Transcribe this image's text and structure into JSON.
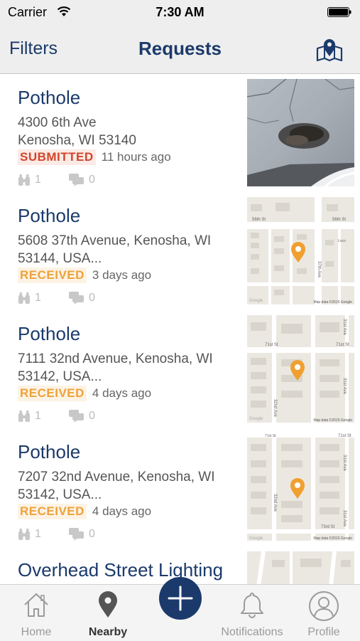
{
  "status_bar": {
    "carrier": "Carrier",
    "time": "7:30 AM"
  },
  "nav": {
    "filters_label": "Filters",
    "title": "Requests",
    "map_icon": "map-pin-icon"
  },
  "requests": [
    {
      "title": "Pothole",
      "address": "4300 6th Ave\nKenosha, WI 53140",
      "status": "SUBMITTED",
      "age": "11 hours ago",
      "supporters": "1",
      "comments": "0",
      "thumb": "photo"
    },
    {
      "title": "Pothole",
      "address": "5608 37th Avenue, Kenosha, WI 53144, USA...",
      "status": "RECEIVED",
      "age": "3 days ago",
      "supporters": "1",
      "comments": "0",
      "thumb": "map",
      "map_labels": [
        "56th St",
        "56th St",
        "37th Ave",
        "Loco",
        "Google",
        "Map data ©2015 Google"
      ]
    },
    {
      "title": "Pothole",
      "address": "7111 32nd Avenue, Kenosha, WI 53142, USA...",
      "status": "RECEIVED",
      "age": "4 days ago",
      "supporters": "1",
      "comments": "0",
      "thumb": "map",
      "map_labels": [
        "71st St",
        "71st St",
        "31st Ave",
        "32nd Ave",
        "31st Ave",
        "Google",
        "Map data ©2015 Google"
      ]
    },
    {
      "title": "Pothole",
      "address": "7207 32nd Avenue, Kenosha, WI 53142, USA...",
      "status": "RECEIVED",
      "age": "4 days ago",
      "supporters": "1",
      "comments": "0",
      "thumb": "map",
      "map_labels": [
        "71st St",
        "71st St",
        "31st Ave",
        "32nd Ave",
        "31st Ave",
        "73rd St",
        "Google",
        "Map data ©2015 Google"
      ]
    },
    {
      "title": "Overhead Street Lighting",
      "thumb": "map"
    }
  ],
  "tabs": [
    {
      "label": "Home",
      "icon": "home-icon"
    },
    {
      "label": "Nearby",
      "icon": "location-pin-icon",
      "active": true
    },
    {
      "label": "Notifications",
      "icon": "bell-icon"
    },
    {
      "label": "Profile",
      "icon": "user-icon"
    }
  ],
  "add_button_icon": "plus-icon",
  "colors": {
    "nav_blue": "#1b3a6b",
    "submitted": "#d2452b",
    "received": "#eea13a",
    "map_pin": "#f0a030"
  }
}
